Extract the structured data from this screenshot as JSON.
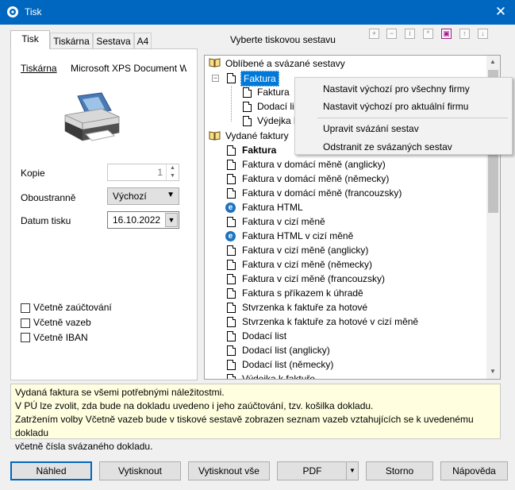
{
  "window": {
    "title": "Tisk",
    "close_glyph": "✕"
  },
  "tabs": [
    {
      "label": "Tisk"
    },
    {
      "label": "Tiskárna"
    },
    {
      "label": "Sestava"
    },
    {
      "label": "A4"
    }
  ],
  "left": {
    "printer_label": "Tiskárna",
    "printer_name": "Microsoft XPS Document W",
    "copies_label": "Kopie",
    "copies_value": "1",
    "duplex_label": "Oboustranně",
    "duplex_value": "Výchozí",
    "date_label": "Datum tisku",
    "date_value": "16.10.2022",
    "checkboxes": [
      {
        "label": "Včetně zaúčtování",
        "checked": false
      },
      {
        "label": "Včetně vazeb",
        "checked": false
      },
      {
        "label": "Včetně IBAN",
        "checked": false
      }
    ]
  },
  "report_header": "Vyberte tiskovou sestavu",
  "toolbar_icons": [
    "add-icon",
    "remove-icon",
    "info-icon",
    "star-icon",
    "report-icon",
    "up-icon",
    "down-icon"
  ],
  "tree": {
    "group1": "Oblíbené a svázané sestavy",
    "fav_item": "Faktura",
    "fav_children": [
      "Faktura",
      "Dodací list",
      "Výdejka k faktuře"
    ],
    "group2": "Vydané faktury",
    "items": [
      {
        "label": "Faktura",
        "bold": true,
        "icon": "doc"
      },
      {
        "label": "Faktura v domácí měně (anglicky)",
        "icon": "doc"
      },
      {
        "label": "Faktura v domácí měně (německy)",
        "icon": "doc"
      },
      {
        "label": "Faktura v domácí měně (francouzsky)",
        "icon": "doc"
      },
      {
        "label": "Faktura HTML",
        "icon": "ie"
      },
      {
        "label": "Faktura v cizí měně",
        "icon": "doc"
      },
      {
        "label": "Faktura HTML v cizí měně",
        "icon": "ie"
      },
      {
        "label": "Faktura v cizí měně (anglicky)",
        "icon": "doc"
      },
      {
        "label": "Faktura v cizí měně (německy)",
        "icon": "doc"
      },
      {
        "label": "Faktura v cizí měně (francouzsky)",
        "icon": "doc"
      },
      {
        "label": "Faktura s příkazem k úhradě",
        "icon": "doc"
      },
      {
        "label": "Stvrzenka k faktuře za hotové",
        "icon": "doc"
      },
      {
        "label": "Stvrzenka k faktuře za hotové v cizí měně",
        "icon": "doc"
      },
      {
        "label": "Dodací list",
        "icon": "doc"
      },
      {
        "label": "Dodací list (anglicky)",
        "icon": "doc"
      },
      {
        "label": "Dodací list (německy)",
        "icon": "doc"
      },
      {
        "label": "Výdejka k faktuře",
        "icon": "doc"
      }
    ]
  },
  "context_menu": [
    "Nastavit výchozí pro všechny firmy",
    "Nastavit výchozí pro aktuální firmu",
    "Upravit svázání sestav",
    "Odstranit ze svázaných sestav"
  ],
  "description": [
    "Vydaná faktura se všemi potřebnými náležitostmi.",
    "V PÚ lze zvolit, zda bude na dokladu uvedeno i jeho zaúčtování, tzv. košilka dokladu.",
    "Zatržením volby Včetně vazeb bude v tiskové sestavě zobrazen seznam vazeb vztahujících se k uvedenému dokladu",
    "včetně čísla svázaného dokladu."
  ],
  "buttons": {
    "preview": "Náhled",
    "print": "Vytisknout",
    "print_all": "Vytisknout vše",
    "pdf": "PDF",
    "cancel": "Storno",
    "help": "Nápověda"
  },
  "colors": {
    "titlebar": "#0067c0",
    "selection": "#0078d7",
    "desc_bg": "#ffffe0"
  }
}
